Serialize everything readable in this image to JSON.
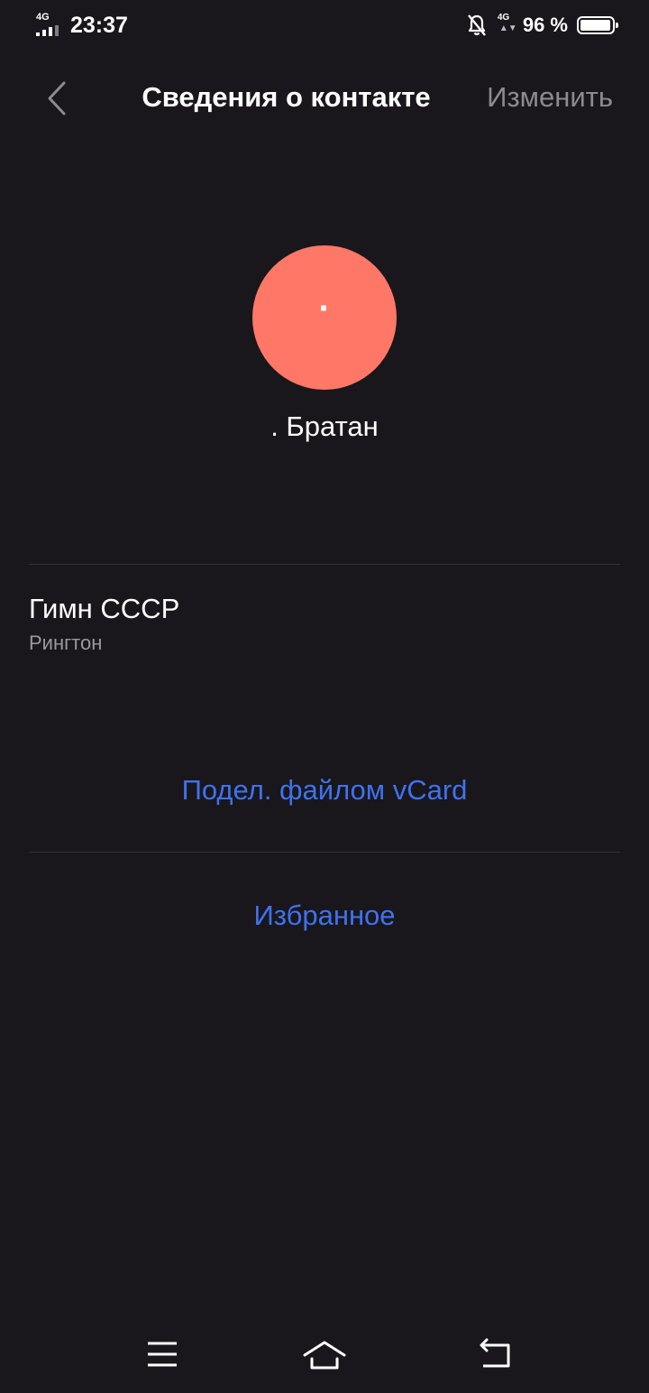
{
  "status_bar": {
    "network_left": "4G",
    "time": "23:37",
    "network_right": "4G",
    "battery_percent": "96 %",
    "battery_level": 0.96,
    "icons": [
      "signal-icon",
      "bell-off-icon",
      "battery-icon"
    ]
  },
  "header": {
    "title": "Сведения о контакте",
    "edit_label": "Изменить",
    "back_icon": "chevron-left-icon"
  },
  "contact": {
    "avatar_initial": "·",
    "avatar_color": "#ff7867",
    "name": ". Братан"
  },
  "ringtone": {
    "value": "Гимн СССР",
    "label": "Рингтон"
  },
  "actions": {
    "share_vcard": "Подел. файлом vCard",
    "favorites": "Избранное"
  },
  "colors": {
    "background": "#19171b",
    "accent": "#3f72f0",
    "secondary_text": "#9a999d"
  },
  "nav_bar": {
    "icons": [
      "menu-icon",
      "home-icon",
      "back-icon"
    ]
  }
}
